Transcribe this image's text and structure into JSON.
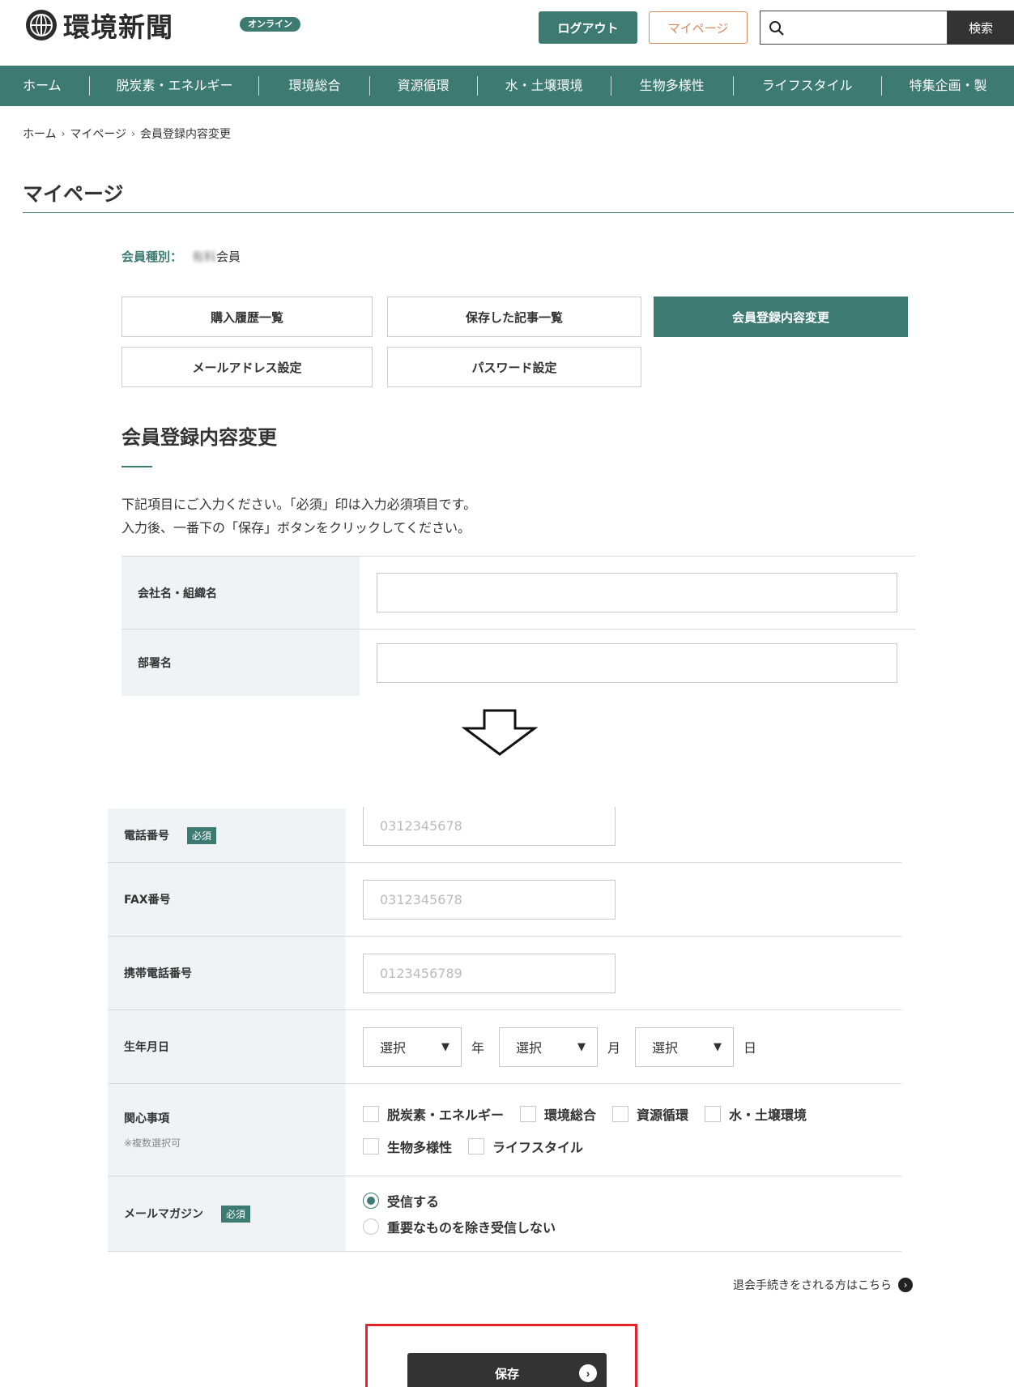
{
  "header": {
    "logo_text": "環境新聞",
    "logo_badge": "オンライン",
    "logout_label": "ログアウト",
    "mypage_label": "マイページ",
    "search_placeholder": "",
    "search_button": "検索"
  },
  "nav": {
    "items": [
      "ホーム",
      "脱炭素・エネルギー",
      "環境総合",
      "資源循環",
      "水・土壌環境",
      "生物多様性",
      "ライフスタイル",
      "特集企画・製"
    ]
  },
  "breadcrumb": [
    "ホーム",
    "マイページ",
    "会員登録内容変更"
  ],
  "page_title": "マイページ",
  "member_type": {
    "label": "会員種別：",
    "value_blurred": "有料",
    "value_suffix": "会員"
  },
  "tabs": [
    "購入履歴一覧",
    "保存した記事一覧",
    "会員登録内容変更",
    "メールアドレス設定",
    "パスワード設定"
  ],
  "section": {
    "title": "会員登録内容変更",
    "intro_line1": "下記項目にご入力ください。「必須」印は入力必須項目です。",
    "intro_line2": "入力後、一番下の「保存」ボタンをクリックしてください。"
  },
  "form_top": {
    "company_label": "会社名・組織名",
    "department_label": "部署名"
  },
  "form_bottom": {
    "required_badge": "必須",
    "phone_label": "電話番号",
    "phone_placeholder": "0312345678",
    "fax_label": "FAX番号",
    "fax_placeholder": "0312345678",
    "mobile_label": "携帯電話番号",
    "mobile_placeholder": "0123456789",
    "birthday_label": "生年月日",
    "select_placeholder": "選択",
    "year_unit": "年",
    "month_unit": "月",
    "day_unit": "日",
    "interests_label": "関心事項",
    "interests_note": "※複数選択可",
    "interests": [
      "脱炭素・エネルギー",
      "環境総合",
      "資源循環",
      "水・土壌環境",
      "生物多様性",
      "ライフスタイル"
    ],
    "newsletter_label": "メールマガジン",
    "newsletter_options": [
      "受信する",
      "重要なものを除き受信しない"
    ],
    "newsletter_selected": "受信する"
  },
  "withdraw_text": "退会手続きをされる方はこちら",
  "save_label": "保存",
  "colors": {
    "accent": "#3d7b72",
    "highlight": "#e0252b",
    "dark": "#333333"
  }
}
